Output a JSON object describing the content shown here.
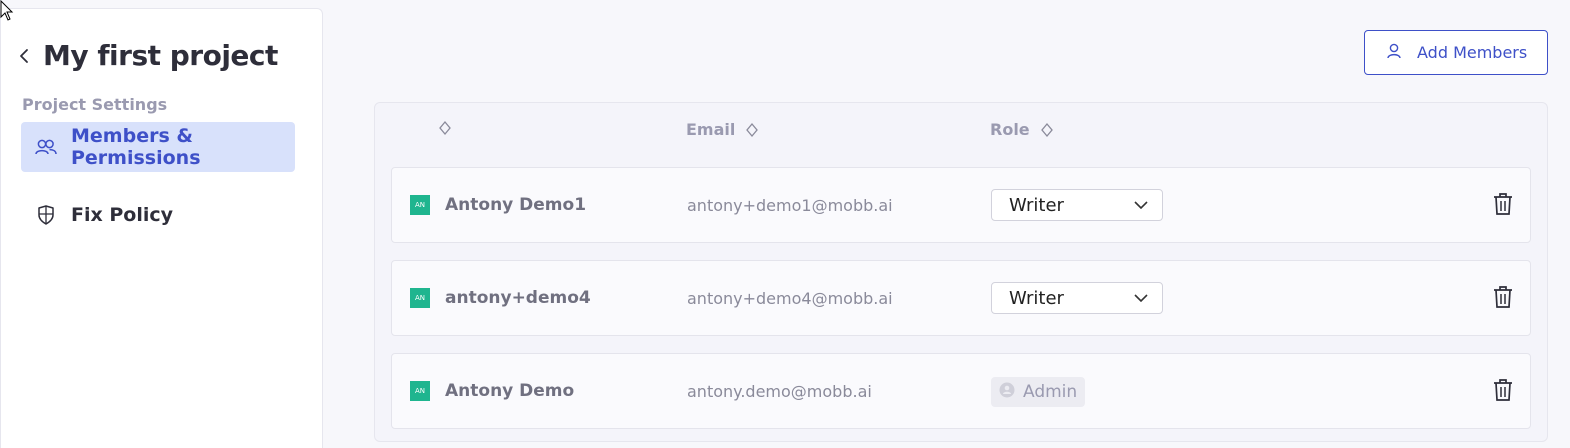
{
  "sidebar": {
    "project_title": "My first project",
    "section_label": "Project Settings",
    "items": [
      {
        "label": "Members & Permissions",
        "icon": "users-icon",
        "active": true
      },
      {
        "label": "Fix Policy",
        "icon": "shield-icon",
        "active": false
      }
    ]
  },
  "toolbar": {
    "add_members_label": "Add Members",
    "icon": "user-icon"
  },
  "table": {
    "columns": [
      {
        "label": "",
        "sortable": true
      },
      {
        "label": "Email",
        "sortable": true
      },
      {
        "label": "Role",
        "sortable": true
      }
    ],
    "rows": [
      {
        "avatar": "AN",
        "name": "Antony Demo1",
        "email": "antony+demo1@mobb.ai",
        "role": "Writer",
        "role_type": "select"
      },
      {
        "avatar": "AN",
        "name": "antony+demo4",
        "email": "antony+demo4@mobb.ai",
        "role": "Writer",
        "role_type": "select"
      },
      {
        "avatar": "AN",
        "name": "Antony Demo",
        "email": "antony.demo@mobb.ai",
        "role": "Admin",
        "role_type": "badge"
      }
    ]
  },
  "colors": {
    "accent": "#3e50c8",
    "active_nav_bg": "#d8e1fb",
    "avatar_bg": "#1fb58f"
  }
}
